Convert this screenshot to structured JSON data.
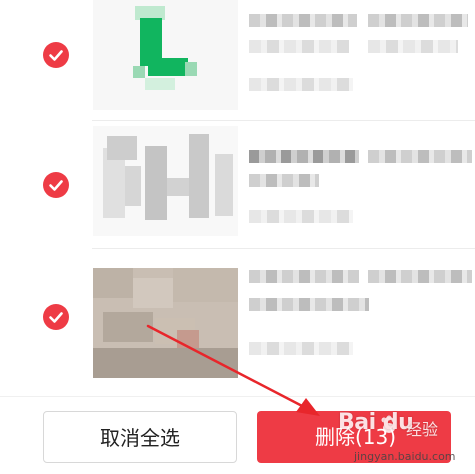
{
  "colors": {
    "accent": "#ee3b45",
    "arrow": "#e8262b",
    "thumb_green": "#11b55f"
  },
  "items": [
    {
      "checked": true,
      "thumbnail": "green-l-logo-thumbnail"
    },
    {
      "checked": true,
      "thumbnail": "gray-blurred-thumbnail"
    },
    {
      "checked": true,
      "thumbnail": "photo-blurred-thumbnail"
    }
  ],
  "bottom_bar": {
    "cancel_label": "取消全选",
    "delete_label": "删除(13)"
  },
  "watermark": {
    "brand": "Bai du",
    "jingyan": "经验",
    "domain": "jingyan.baidu.com"
  }
}
